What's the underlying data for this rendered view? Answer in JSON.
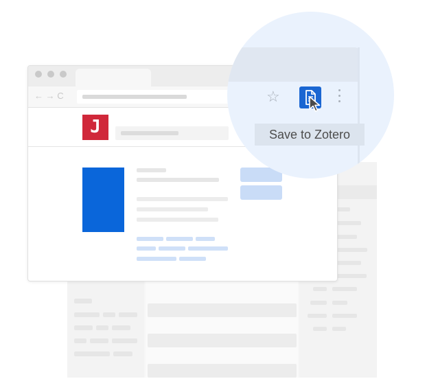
{
  "tooltip": {
    "text": "Save to Zotero"
  },
  "site": {
    "logo_letter": "J"
  },
  "toolbar": {
    "nav_glyphs": "← → C",
    "star_glyph": "☆"
  },
  "colors": {
    "accent_blue": "#1a66d2",
    "cover_blue": "#0a66da",
    "logo_red": "#d0283a",
    "magnifier_bg": "#eaf2fd",
    "placeholder_blue": "#c9dcf7"
  },
  "icons": {
    "zotero_extension": "document-save-icon",
    "star": "bookmark-star-icon",
    "menu": "kebab-menu-icon",
    "cursor": "mouse-pointer-icon"
  }
}
